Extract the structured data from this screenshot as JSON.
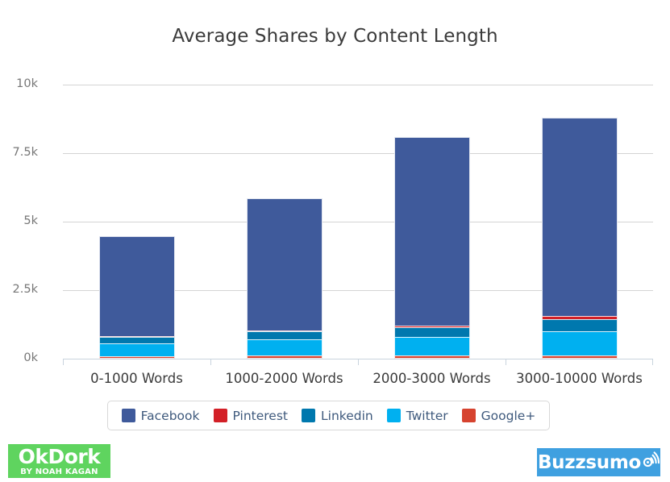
{
  "chart_data": {
    "type": "bar",
    "stacked": true,
    "title": "Average Shares by Content Length",
    "xlabel": "",
    "ylabel": "",
    "categories": [
      "0-1000 Words",
      "1000-2000 Words",
      "2000-3000 Words",
      "3000-10000 Words"
    ],
    "ylim": [
      0,
      10000
    ],
    "yticks": [
      0,
      2500,
      5000,
      7500,
      10000
    ],
    "ytick_labels": [
      "0k",
      "2.5k",
      "5k",
      "7.5k",
      "10k"
    ],
    "grid": true,
    "legend_position": "bottom",
    "series": [
      {
        "name": "Facebook",
        "color": "#3f5a9b",
        "values": [
          3680,
          4850,
          6900,
          7250
        ]
      },
      {
        "name": "Pinterest",
        "color": "#d32027",
        "values": [
          60,
          75,
          90,
          150
        ]
      },
      {
        "name": "Linkedin",
        "color": "#0078ae",
        "values": [
          280,
          320,
          390,
          480
        ]
      },
      {
        "name": "Twitter",
        "color": "#00b0f0",
        "values": [
          480,
          630,
          720,
          900
        ]
      },
      {
        "name": "Google+",
        "color": "#d6432f",
        "values": [
          100,
          105,
          110,
          130
        ]
      }
    ],
    "totals": [
      4600,
      5980,
      8210,
      8910
    ],
    "stack_order_bottom_to_top": [
      "Google+",
      "Twitter",
      "Linkedin",
      "Pinterest",
      "Facebook"
    ]
  },
  "legend": {
    "items": [
      {
        "label": "Facebook",
        "color": "#3f5a9b"
      },
      {
        "label": "Pinterest",
        "color": "#d32027"
      },
      {
        "label": "Linkedin",
        "color": "#0078ae"
      },
      {
        "label": "Twitter",
        "color": "#00b0f0"
      },
      {
        "label": "Google+",
        "color": "#d6432f"
      }
    ]
  },
  "branding": {
    "okdork": {
      "wordmark": "OkDork",
      "tagline": "BY NOAH KAGAN",
      "background": "#5fd45f",
      "text_color": "#ffffff"
    },
    "buzzsumo": {
      "wordmark": "Buzzsumo",
      "background": "#3fa0e0",
      "text_color": "#ffffff",
      "icon": "signal-arc-icon"
    }
  }
}
